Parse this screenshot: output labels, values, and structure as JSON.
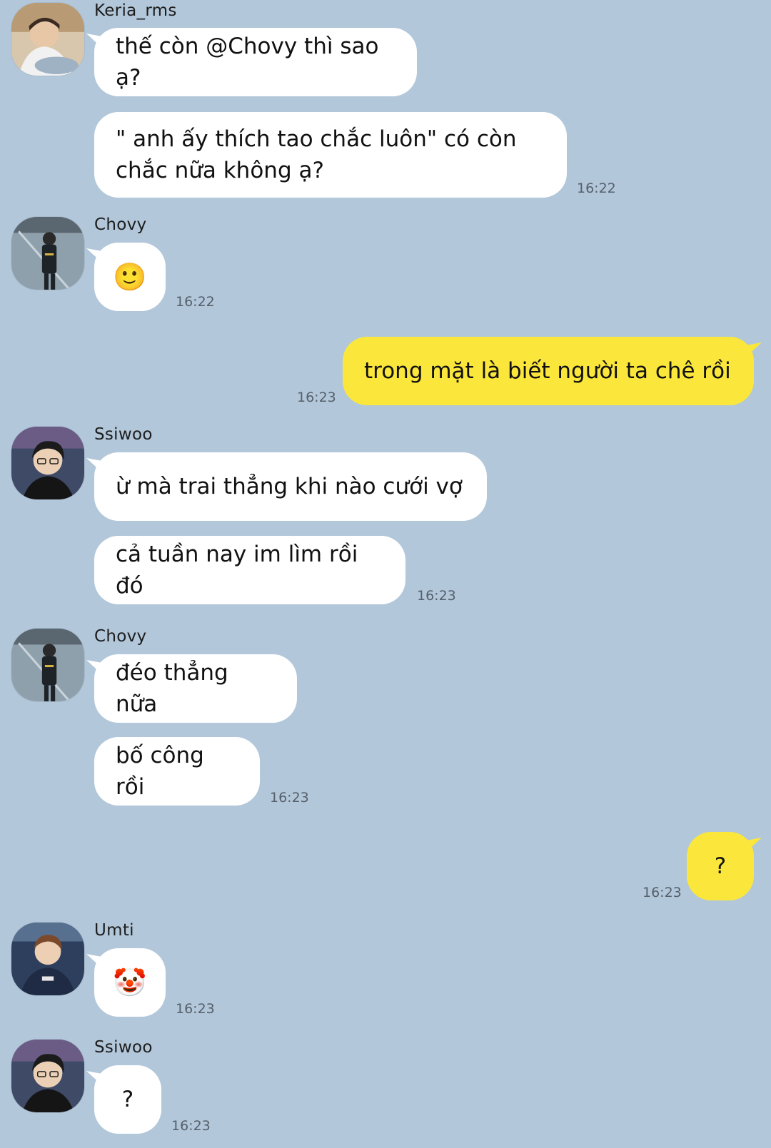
{
  "colors": {
    "background": "#b2c7da",
    "incoming_bubble": "#ffffff",
    "outgoing_bubble": "#fbe73b",
    "timestamp": "#56606b"
  },
  "messages": [
    {
      "sender": "Keria_rms",
      "avatar": "avatar-keria-icon",
      "bubbles": [
        "thế còn @Chovy thì sao ạ?",
        "\" anh ấy thích tao chắc luôn\" có còn\nchắc nữa không ạ?"
      ],
      "time": "16:22"
    },
    {
      "sender": "Chovy",
      "avatar": "avatar-chovy-icon",
      "bubbles": [
        "🙂"
      ],
      "time": "16:22"
    },
    {
      "sender": "me",
      "bubbles": [
        "trong mặt là biết người ta chê rồi"
      ],
      "time": "16:23"
    },
    {
      "sender": "Ssiwoo",
      "avatar": "avatar-ssiwoo-icon",
      "bubbles": [
        "ừ mà trai thẳng khi nào cưới vợ",
        "cả tuần nay im lìm rồi đó"
      ],
      "time": "16:23"
    },
    {
      "sender": "Chovy",
      "avatar": "avatar-chovy-icon",
      "bubbles": [
        "đéo thẳng nữa",
        "bố công rồi"
      ],
      "time": "16:23"
    },
    {
      "sender": "me",
      "bubbles": [
        "?"
      ],
      "time": "16:23"
    },
    {
      "sender": "Umti",
      "avatar": "avatar-umti-icon",
      "bubbles": [
        "🤡"
      ],
      "time": "16:23"
    },
    {
      "sender": "Ssiwoo",
      "avatar": "avatar-ssiwoo-icon",
      "bubbles": [
        "?"
      ],
      "time": "16:23"
    }
  ]
}
